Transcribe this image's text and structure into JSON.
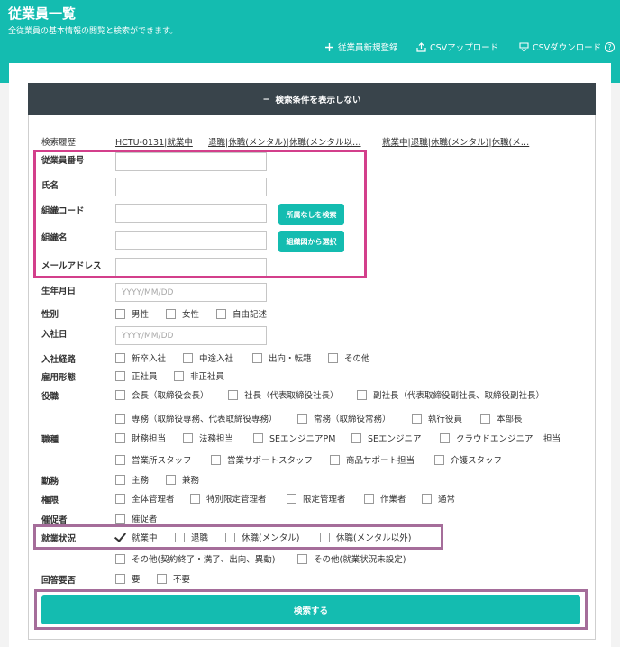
{
  "header": {
    "title": "従業員一覧",
    "subtitle": "全従業員の基本情報の閲覧と検索ができます。",
    "actions": [
      {
        "label": "従業員新規登録",
        "icon": "plus-icon"
      },
      {
        "label": "CSVアップロード",
        "icon": "upload-icon"
      },
      {
        "label": "CSVダウンロード",
        "icon": "download-icon"
      }
    ],
    "help_icon": "?"
  },
  "toggle": {
    "icon": "−",
    "label": "検索条件を表示しない"
  },
  "history": {
    "label": "検索履歴",
    "items": [
      "HCTU-0131|就業中",
      "退職|休職(メンタル)|休職(メンタル以…",
      "就業中|退職|休職(メンタル)|休職(メ…"
    ]
  },
  "fields": {
    "employee_number": {
      "label": "従業員番号",
      "value": "",
      "placeholder": ""
    },
    "name": {
      "label": "氏名",
      "value": "",
      "placeholder": ""
    },
    "org_code": {
      "label": "組織コード",
      "value": "",
      "placeholder": ""
    },
    "org_name": {
      "label": "組織名",
      "value": "",
      "placeholder": ""
    },
    "email": {
      "label": "メールアドレス",
      "value": "",
      "placeholder": ""
    },
    "birthdate": {
      "label": "生年月日",
      "value": "",
      "placeholder": "YYYY/MM/DD"
    },
    "join_date": {
      "label": "入社日",
      "value": "",
      "placeholder": "YYYY/MM/DD"
    }
  },
  "buttons": {
    "search_unassigned": "所属なしを検索",
    "select_from_org_chart": "組織図から選択",
    "search": "検索する"
  },
  "gender": {
    "label": "性別",
    "options": [
      "男性",
      "女性",
      "自由記述"
    ]
  },
  "join_route": {
    "label": "入社経路",
    "options": [
      "新卒入社",
      "中途入社",
      "出向・転籍",
      "その他"
    ]
  },
  "employment_type": {
    "label": "雇用形態",
    "options": [
      "正社員",
      "非正社員"
    ]
  },
  "position": {
    "label": "役職",
    "options": [
      "会長（取締役会長）",
      "社長（代表取締役社長）",
      "副社長（代表取締役副社長、取締役副社長）",
      "専務（取締役専務、代表取締役専務）",
      "常務（取締役常務）",
      "執行役員",
      "本部長"
    ]
  },
  "job_type": {
    "label": "職種",
    "options": [
      "財務担当",
      "法務担当",
      "SEエンジニアPM",
      "SEエンジニア",
      "クラウドエンジニア",
      "営業所スタッフ",
      "営業サポートスタッフ",
      "商品サポート担当",
      "介護スタッフ"
    ],
    "suffix_text": "担当"
  },
  "work": {
    "label": "勤務",
    "options": [
      "主務",
      "兼務"
    ]
  },
  "authority": {
    "label": "権限",
    "options": [
      "全体管理者",
      "特別限定管理者",
      "限定管理者",
      "作業者",
      "通常"
    ]
  },
  "reminder": {
    "label": "催促者",
    "options": [
      "催促者"
    ]
  },
  "employment_status": {
    "label": "就業状況",
    "options": [
      {
        "label": "就業中",
        "checked": true
      },
      {
        "label": "退職",
        "checked": false
      },
      {
        "label": "休職(メンタル)",
        "checked": false
      },
      {
        "label": "休職(メンタル以外)",
        "checked": false
      },
      {
        "label": "その他(契約終了・満了、出向、異動)",
        "checked": false
      },
      {
        "label": "その他(就業状況未設定)",
        "checked": false
      }
    ]
  },
  "answer_required": {
    "label": "回答要否",
    "options": [
      "要",
      "不要"
    ]
  },
  "colors": {
    "brand": "#14bcb0",
    "dark_bar": "#39444b",
    "highlight_pink": "#d33f8b",
    "highlight_purple": "#a56d9a"
  }
}
